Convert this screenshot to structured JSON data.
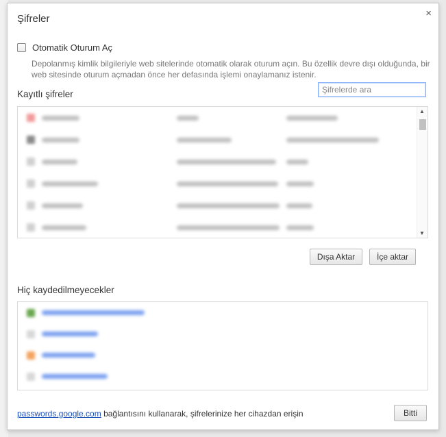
{
  "dialog": {
    "title": "Şifreler",
    "close_glyph": "×",
    "auto_signin": {
      "label": "Otomatik Oturum Aç",
      "checked": false,
      "description": "Depolanmış kimlik bilgileriyle web sitelerinde otomatik olarak oturum açın. Bu özellik devre dışı olduğunda, bir web sitesinde oturum açmadan önce her defasında işlemi onaylamanız istenir."
    },
    "saved_passwords": {
      "title": "Kayıtlı şifreler",
      "search_placeholder": "Şifrelerde ara",
      "rows": [
        {
          "favicon_color": "#f29a9a"
        },
        {
          "favicon_color": "#8a8a8a"
        },
        {
          "favicon_color": "#d0d0d0"
        },
        {
          "favicon_color": "#d0d0d0"
        },
        {
          "favicon_color": "#d0d0d0"
        },
        {
          "favicon_color": "#d0d0d0"
        }
      ],
      "export_label": "Dışa Aktar",
      "import_label": "İçe aktar"
    },
    "never_saved": {
      "title": "Hiç kaydedilmeyecekler",
      "rows": [
        {
          "favicon_color": "#6aa84f"
        },
        {
          "favicon_color": "#d8d8d8"
        },
        {
          "favicon_color": "#f4a460"
        },
        {
          "favicon_color": "#d8d8d8"
        }
      ]
    },
    "footer": {
      "link_text": "passwords.google.com",
      "text": " bağlantısını kullanarak, şifrelerinize her cihazdan erişin",
      "done_label": "Bitti"
    }
  }
}
